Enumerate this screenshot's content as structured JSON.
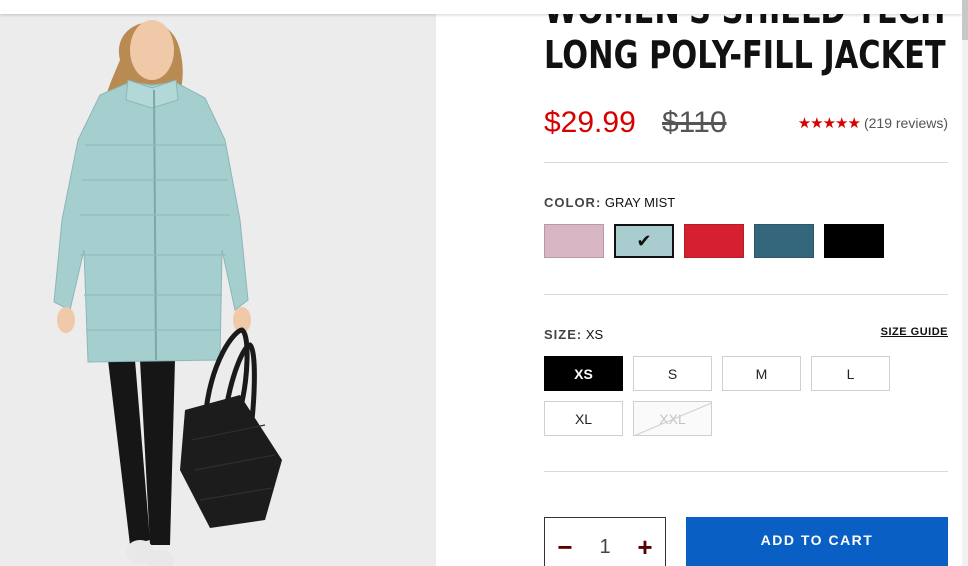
{
  "product": {
    "title_line1": "WOMEN'S SHIELD TECH",
    "title_line2": "LONG POLY-FILL JACKET",
    "sale_price": "$29.99",
    "original_price": "$110",
    "rating": {
      "stars": "★★★★★",
      "reviews_text": "(219 reviews)",
      "value": 5
    }
  },
  "color": {
    "label": "COLOR:",
    "selected_value": "GRAY MIST",
    "swatches": [
      {
        "name": "pink",
        "hex": "#d8b6c4"
      },
      {
        "name": "gray-mist",
        "hex": "#a9cccf",
        "selected": true
      },
      {
        "name": "red",
        "hex": "#d7202f"
      },
      {
        "name": "teal",
        "hex": "#35677c"
      },
      {
        "name": "black",
        "hex": "#000000"
      }
    ],
    "check_glyph": "✔"
  },
  "size": {
    "label": "SIZE:",
    "selected_value": "XS",
    "guide_label": "SIZE GUIDE",
    "options": [
      "XS",
      "S",
      "M",
      "L",
      "XL",
      "XXL"
    ]
  },
  "quantity": {
    "minus": "−",
    "value": "1",
    "plus": "+"
  },
  "cart": {
    "add_label": "ADD TO CART"
  },
  "colors": {
    "sale_red": "#d50000",
    "cart_blue": "#0a5fc4",
    "image_bg": "#ececec"
  }
}
